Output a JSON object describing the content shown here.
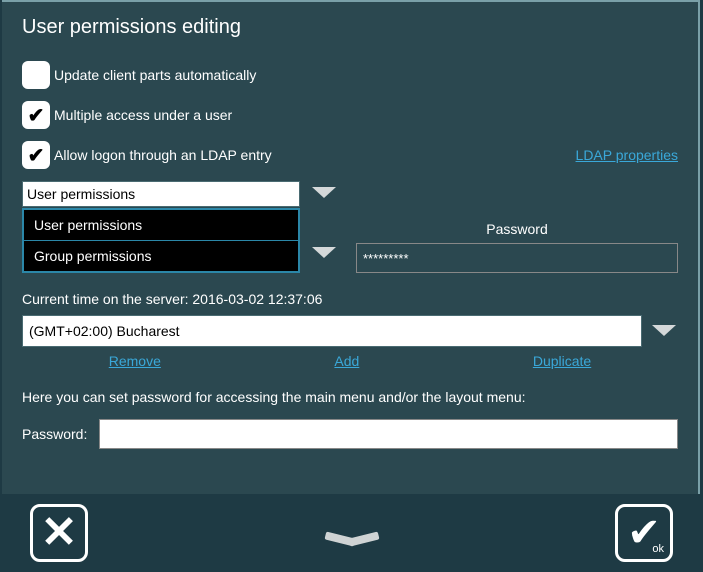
{
  "dialog": {
    "title": "User permissions editing"
  },
  "checkboxes": {
    "auto_update": "Update client parts automatically",
    "multi_access": "Multiple access under a user",
    "ldap_logon": "Allow logon through an LDAP entry"
  },
  "links": {
    "ldap_props": "LDAP properties",
    "remove": "Remove",
    "add": "Add",
    "duplicate": "Duplicate"
  },
  "permission_select": {
    "value": "User permissions",
    "options": [
      "User permissions",
      "Group permissions"
    ]
  },
  "password_field": {
    "label": "Password",
    "value": "*********"
  },
  "server_time_label": "Current time on the server: 2016-03-02 12:37:06",
  "timezone": {
    "value": "(GMT+02:00) Bucharest"
  },
  "password_desc": "Here you can set password for accessing the main menu and/or the layout menu:",
  "password2_label": "Password:",
  "footer": {
    "ok_label": "ok"
  }
}
